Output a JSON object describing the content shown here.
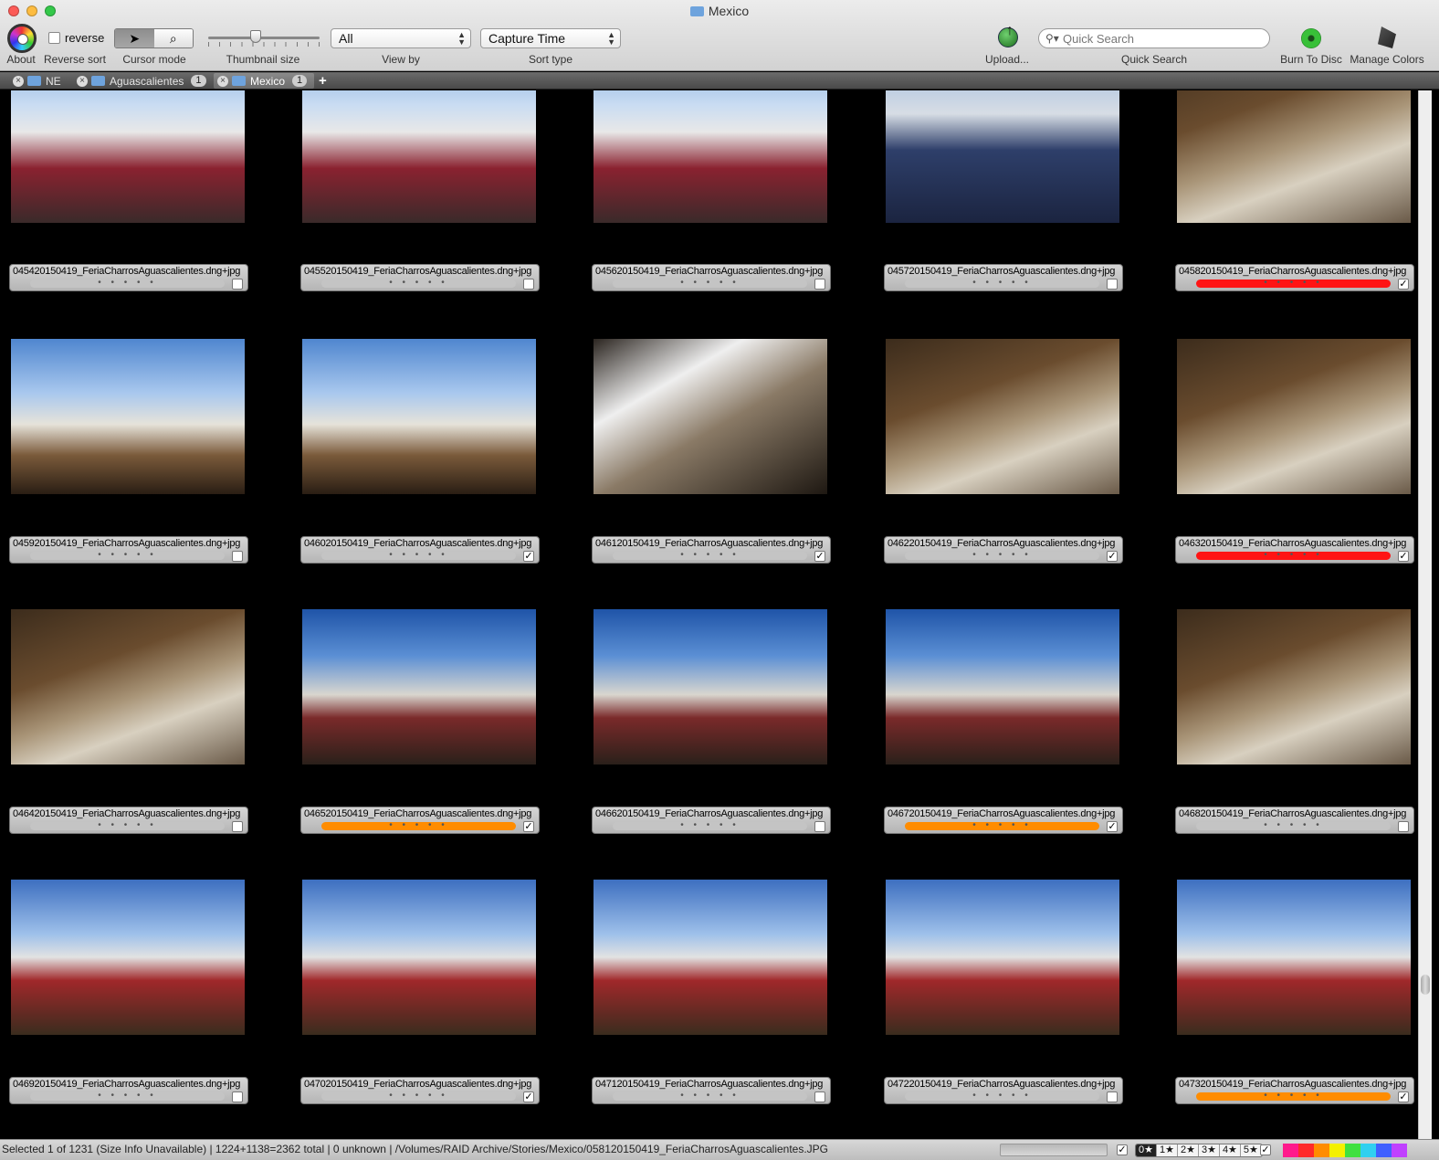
{
  "window": {
    "title": "Mexico"
  },
  "toolbar": {
    "about_label": "About",
    "reverse_checkbox": "reverse",
    "reverse_label": "Reverse sort",
    "cursor_label": "Cursor mode",
    "thumb_label": "Thumbnail size",
    "thumb_size_level": 0.43,
    "view_value": "All",
    "view_label": "View by",
    "sort_value": "Capture Time",
    "sort_label": "Sort type",
    "upload_label": "Upload...",
    "search_placeholder": "Quick Search",
    "search_label": "Quick Search",
    "burn_label": "Burn To Disc",
    "colors_label": "Manage Colors",
    "colors": {
      "red": "#ff1414",
      "orange": "#ff8c00",
      "chrome": "#d2d2d2"
    }
  },
  "tabs": [
    {
      "label": "NE",
      "badge": ""
    },
    {
      "label": "Aguascalientes",
      "badge": "1"
    },
    {
      "label": "Mexico",
      "badge": "1"
    }
  ],
  "grid": {
    "rating_dots": "• • • • •",
    "check_mark": "✓",
    "items": [
      {
        "name": "045420150419_FeriaCharrosAguascalientes.dng+jpg",
        "label": "none",
        "checked": false,
        "scene": "a"
      },
      {
        "name": "045520150419_FeriaCharrosAguascalientes.dng+jpg",
        "label": "none",
        "checked": false,
        "scene": "a"
      },
      {
        "name": "045620150419_FeriaCharrosAguascalientes.dng+jpg",
        "label": "none",
        "checked": false,
        "scene": "a"
      },
      {
        "name": "045720150419_FeriaCharrosAguascalientes.dng+jpg",
        "label": "none",
        "checked": false,
        "scene": "b"
      },
      {
        "name": "045820150419_FeriaCharrosAguascalientes.dng+jpg",
        "label": "red",
        "checked": true,
        "scene": "c"
      },
      {
        "name": "045920150419_FeriaCharrosAguascalientes.dng+jpg",
        "label": "none",
        "checked": false,
        "scene": "d"
      },
      {
        "name": "046020150419_FeriaCharrosAguascalientes.dng+jpg",
        "label": "none",
        "checked": true,
        "scene": "d"
      },
      {
        "name": "046120150419_FeriaCharrosAguascalientes.dng+jpg",
        "label": "none",
        "checked": true,
        "scene": "e"
      },
      {
        "name": "046220150419_FeriaCharrosAguascalientes.dng+jpg",
        "label": "none",
        "checked": true,
        "scene": "c"
      },
      {
        "name": "046320150419_FeriaCharrosAguascalientes.dng+jpg",
        "label": "red",
        "checked": true,
        "scene": "c"
      },
      {
        "name": "046420150419_FeriaCharrosAguascalientes.dng+jpg",
        "label": "none",
        "checked": false,
        "scene": "c"
      },
      {
        "name": "046520150419_FeriaCharrosAguascalientes.dng+jpg",
        "label": "orange",
        "checked": true,
        "scene": "f"
      },
      {
        "name": "046620150419_FeriaCharrosAguascalientes.dng+jpg",
        "label": "none",
        "checked": false,
        "scene": "f"
      },
      {
        "name": "046720150419_FeriaCharrosAguascalientes.dng+jpg",
        "label": "orange",
        "checked": true,
        "scene": "f"
      },
      {
        "name": "046820150419_FeriaCharrosAguascalientes.dng+jpg",
        "label": "none",
        "checked": false,
        "scene": "c"
      },
      {
        "name": "046920150419_FeriaCharrosAguascalientes.dng+jpg",
        "label": "none",
        "checked": false,
        "scene": "g"
      },
      {
        "name": "047020150419_FeriaCharrosAguascalientes.dng+jpg",
        "label": "none",
        "checked": true,
        "scene": "g"
      },
      {
        "name": "047120150419_FeriaCharrosAguascalientes.dng+jpg",
        "label": "none",
        "checked": false,
        "scene": "g"
      },
      {
        "name": "047220150419_FeriaCharrosAguascalientes.dng+jpg",
        "label": "none",
        "checked": false,
        "scene": "g"
      },
      {
        "name": "047320150419_FeriaCharrosAguascalientes.dng+jpg",
        "label": "orange",
        "checked": true,
        "scene": "g"
      }
    ]
  },
  "status": {
    "text": "Selected 1 of 1231 (Size Info Unavailable) | 1224+1138=2362 total | 0 unknown | /Volumes/RAID Archive/Stories/Mexico/058120150419_FeriaCharrosAguascalientes.JPG",
    "ratings": [
      "0★",
      "1★",
      "2★",
      "3★",
      "4★",
      "5★"
    ],
    "check_mark": "✓",
    "label_chips": [
      "#ff1a8c",
      "#ff2a2a",
      "#ff8c00",
      "#f4f000",
      "#40e040",
      "#30d0f0",
      "#4060ff",
      "#c040ff"
    ]
  },
  "scroll": {
    "position": 0.86
  }
}
